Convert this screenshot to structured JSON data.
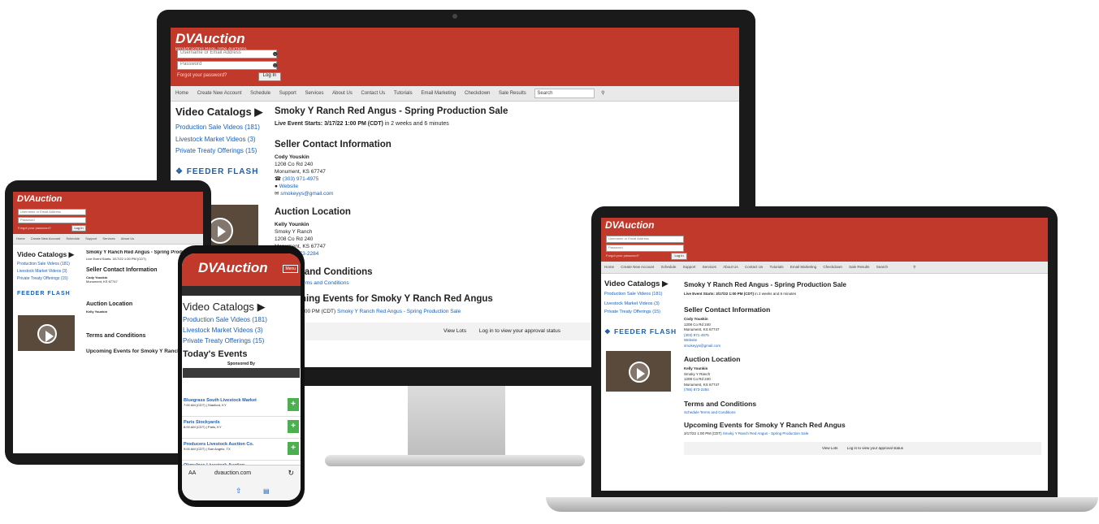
{
  "site": {
    "brand": "DVAuction",
    "tagline": "Broadcasting Real-Time Auctions",
    "username_placeholder": "Username or Email Address",
    "password_placeholder": "Password",
    "forgot": "Forgot your password?",
    "login": "Log In",
    "nav": [
      "Home",
      "Create New Account",
      "Schedule",
      "Support",
      "Services",
      "About Us",
      "Contact Us",
      "Tutorials",
      "Email Marketing",
      "Checkdown",
      "Sale Results",
      "Search"
    ]
  },
  "sidebar": {
    "catalogs_title": "Video Catalogs",
    "links": [
      "Production Sale Videos (181)",
      "Livestock Market Videos (3)",
      "Private Treaty Offerings (15)"
    ],
    "feeder": "FEEDER FLASH"
  },
  "main": {
    "sale_title": "Smoky Y Ranch Red Angus - Spring Production Sale",
    "live_event": "Live Event Starts: 3/17/22 1:00 PM (CDT)",
    "live_event_suffix": "in 2 weeks and 6 minutes",
    "seller_heading": "Seller Contact Information",
    "seller_name": "Cody Youskin",
    "seller_addr1": "1208 Co Rd 240",
    "seller_addr2": "Monument, KS 67747",
    "seller_phone": "(303) 971-4975",
    "seller_website": "Website",
    "seller_email": "smokeyys@gmail.com",
    "location_heading": "Auction Location",
    "loc_name": "Kelly Younkin",
    "loc_ranch": "Smoky Y Ranch",
    "loc_addr1": "1208 Co Rd 240",
    "loc_addr2": "Monument, KS 67747",
    "loc_phone": "(785) 873-2284",
    "terms_heading": "Terms and Conditions",
    "terms_link": "Schedule Terms and Conditions",
    "upcoming_heading": "Upcoming Events for Smoky Y Ranch Red Angus",
    "upcoming_item_time": "3/17/22 1:00 PM (CDT)",
    "upcoming_item_link": "Smoky Y Ranch Red Angus - Spring Production Sale",
    "view_lots": "View Lots",
    "login_status": "Log in to view your approval status"
  },
  "phone": {
    "menu": "Menu",
    "todays_events": "Today's Events",
    "sponsored_by": "Sponsored By",
    "events": [
      {
        "name": "Bluegrass South Livestock Market",
        "time": "7:00 AM (CDT) | Stanford, KY"
      },
      {
        "name": "Paris Stockyards",
        "time": "8:00 AM (CDT) | Paris, KY"
      },
      {
        "name": "Producers Livestock Auction Co.",
        "time": "9:00 AM (CDT) | San Angelo, TX"
      },
      {
        "name": "Okmulgee Livestock Auction",
        "time": ""
      }
    ],
    "plus": "+",
    "url_bar": "dvauction.com",
    "aa": "AA"
  },
  "colors": {
    "brand_red": "#c0392b",
    "link_blue": "#1a5fb4",
    "green": "#4caf50"
  }
}
